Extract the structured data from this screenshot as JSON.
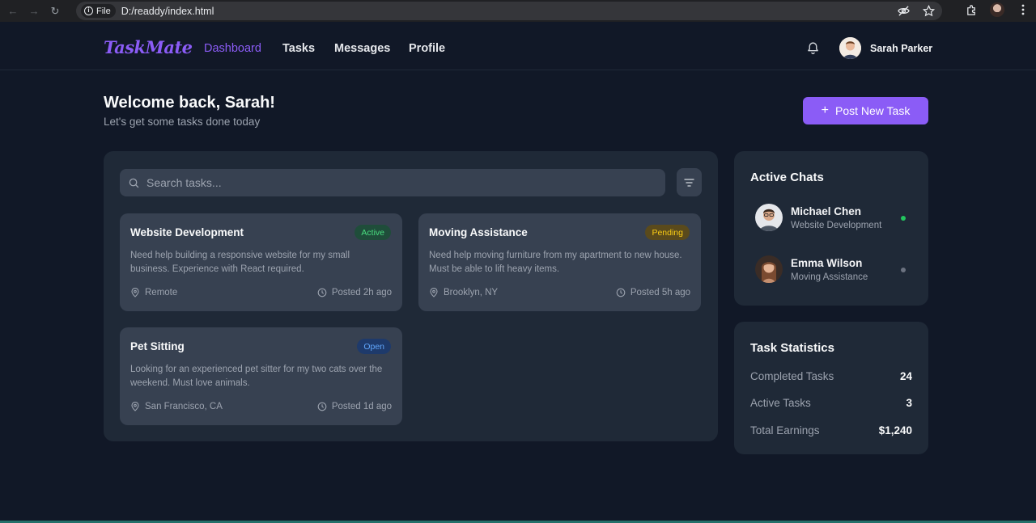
{
  "browser": {
    "file_chip": "File",
    "url": "D:/readdy/index.html"
  },
  "nav": {
    "logo": "TaskMate",
    "links": [
      "Dashboard",
      "Tasks",
      "Messages",
      "Profile"
    ],
    "user_name": "Sarah Parker"
  },
  "header": {
    "welcome": "Welcome back, Sarah!",
    "subtitle": "Let's get some tasks done today",
    "post_button": "Post New Task"
  },
  "search": {
    "placeholder": "Search tasks..."
  },
  "tasks": [
    {
      "title": "Website Development",
      "status": "Active",
      "description": "Need help building a responsive website for my small business. Experience with React required.",
      "location": "Remote",
      "posted": "Posted 2h ago"
    },
    {
      "title": "Moving Assistance",
      "status": "Pending",
      "description": "Need help moving furniture from my apartment to new house. Must be able to lift heavy items.",
      "location": "Brooklyn, NY",
      "posted": "Posted 5h ago"
    },
    {
      "title": "Pet Sitting",
      "status": "Open",
      "description": "Looking for an experienced pet sitter for my two cats over the weekend. Must love animals.",
      "location": "San Francisco, CA",
      "posted": "Posted 1d ago"
    }
  ],
  "chats": {
    "title": "Active Chats",
    "items": [
      {
        "name": "Michael Chen",
        "topic": "Website Development",
        "online": true
      },
      {
        "name": "Emma Wilson",
        "topic": "Moving Assistance",
        "online": false
      }
    ]
  },
  "stats": {
    "title": "Task Statistics",
    "items": [
      {
        "label": "Completed Tasks",
        "value": "24"
      },
      {
        "label": "Active Tasks",
        "value": "3"
      },
      {
        "label": "Total Earnings",
        "value": "$1,240"
      }
    ]
  },
  "colors": {
    "accent": "#8b5cf6",
    "background": "#111827",
    "panel": "#1f2937",
    "card": "#374151",
    "online": "#22c55e",
    "offline": "#6b7280"
  }
}
